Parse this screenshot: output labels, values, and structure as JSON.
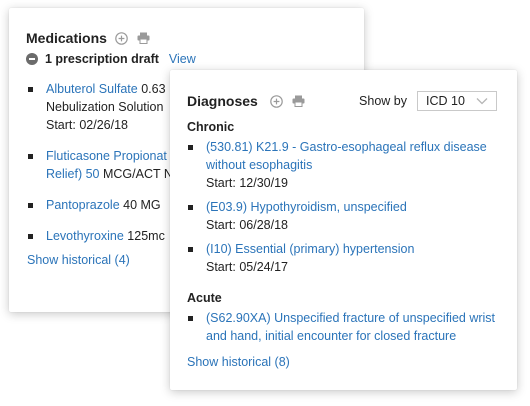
{
  "medications": {
    "title": "Medications",
    "draft_text": "1 prescription draft",
    "view_label": "View",
    "items": [
      {
        "name": "Albuterol Sulfate",
        "detail": " 0.63",
        "line2": "Nebulization Solution",
        "start": "Start: 02/26/18"
      },
      {
        "name": "Fluticasone Propionat",
        "line2_link": "Relief) 50",
        "line2_rest": " MCG/ACT N"
      },
      {
        "name": "Pantoprazole",
        "detail": " 40 MG"
      },
      {
        "name": "Levothyroxine",
        "detail": " 125mc"
      }
    ],
    "show_historical": "Show historical (4)"
  },
  "diagnoses": {
    "title": "Diagnoses",
    "show_by_label": "Show by",
    "code_system": "ICD 10",
    "sections": [
      {
        "title": "Chronic",
        "items": [
          {
            "link": "(530.81) K21.9 - Gastro-esophageal reflux disease without esophagitis",
            "start": "Start: 12/30/19"
          },
          {
            "link": "(E03.9) Hypothyroidism, unspecified",
            "start": "Start: 06/28/18"
          },
          {
            "link": "(I10) Essential (primary) hypertension",
            "start": "Start: 05/24/17"
          }
        ]
      },
      {
        "title": "Acute",
        "items": [
          {
            "link": "(S62.90XA) Unspecified fracture of unspecified wrist and hand, initial encounter for closed fracture"
          }
        ]
      }
    ],
    "show_historical": "Show historical (8)"
  },
  "icons": [
    "add-circle-icon",
    "print-icon",
    "minus-circle-icon",
    "chevron-down-icon"
  ],
  "colors": {
    "link": "#2b74b9",
    "text": "#222222",
    "icon": "#9a9a9a"
  }
}
